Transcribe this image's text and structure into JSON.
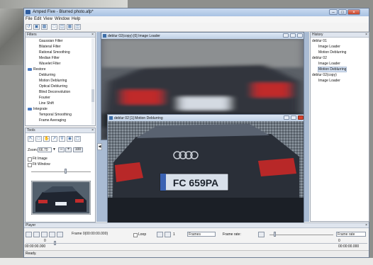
{
  "app": {
    "title": "Amped Five - Blurred photo.afp*",
    "controls": [
      "–",
      "□",
      "×"
    ]
  },
  "menu": [
    "File",
    "Edit",
    "View",
    "Window",
    "Help"
  ],
  "filters_panel": {
    "title": "Filters",
    "items": [
      {
        "label": "Gaussian Filter",
        "folder": false
      },
      {
        "label": "Bilateral Filter",
        "folder": false
      },
      {
        "label": "Rational Smoothing",
        "folder": false
      },
      {
        "label": "Median Filter",
        "folder": false
      },
      {
        "label": "Wavelet Filter",
        "folder": false
      },
      {
        "label": "Restore",
        "folder": true
      },
      {
        "label": "Deblurring",
        "folder": false
      },
      {
        "label": "Motion Deblurring",
        "folder": false
      },
      {
        "label": "Optical Deblurring",
        "folder": false
      },
      {
        "label": "Blind Deconvolution",
        "folder": false
      },
      {
        "label": "Fourier",
        "folder": false
      },
      {
        "label": "Line Shift",
        "folder": false
      },
      {
        "label": "Integrate",
        "folder": true
      },
      {
        "label": "Temporal Smoothing",
        "folder": false
      },
      {
        "label": "Frame Averaging",
        "folder": false
      }
    ]
  },
  "tools_panel": {
    "title": "Tools",
    "zoom_label": "Zoom:",
    "zoom_value": "66.70",
    "zoom_100": "100",
    "fit_image": "Fit Image",
    "fit_window": "Fit Window"
  },
  "history_panel": {
    "title": "History",
    "items": [
      {
        "label": "deblur 01",
        "indent": false
      },
      {
        "label": "Image Loader",
        "indent": true
      },
      {
        "label": "Motion Deblurring",
        "indent": true
      },
      {
        "label": "deblur 02",
        "indent": false
      },
      {
        "label": "Image Loader",
        "indent": true
      },
      {
        "label": "Motion Deblurring",
        "indent": true,
        "selected": true
      },
      {
        "label": "deblur 02(copy)",
        "indent": false
      },
      {
        "label": "Image Loader",
        "indent": true
      }
    ]
  },
  "doc1": {
    "title": "deblur 02(copy) [0] Image Loader"
  },
  "doc2": {
    "title": "deblur 02 [1] Motion Deblurring",
    "plate": "FC 659PA"
  },
  "player": {
    "title": "Player",
    "frame_label": "Frame 0(00:00:00.000)",
    "loop_label": "Loop",
    "step_value": "1",
    "frames_select": "Frames",
    "frame_rate_label": "Frame rate:",
    "frame_rate_select": "Frame rate",
    "left_value": "0",
    "left_time": "00:00:00.000",
    "right_value": "0",
    "right_time": "00:00:00.000"
  },
  "status": "Ready."
}
